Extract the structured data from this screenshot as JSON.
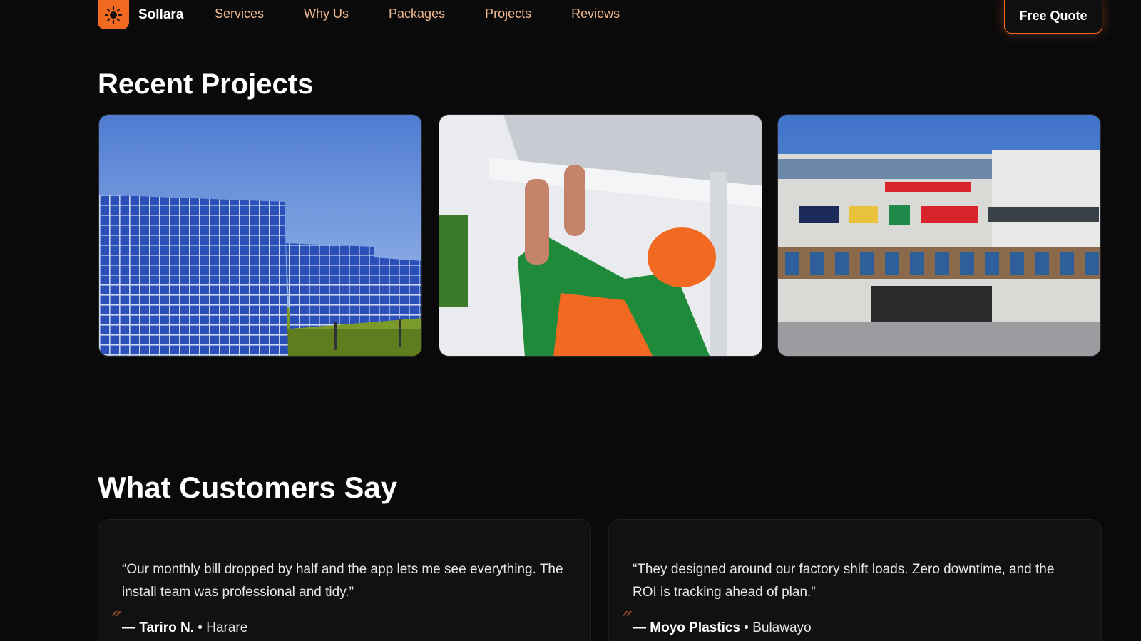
{
  "brand": {
    "name": "Sollara",
    "logo_icon": "sun-icon",
    "accent": "#f26a21"
  },
  "nav": {
    "links": [
      "Services",
      "Why Us",
      "Packages",
      "Projects",
      "Reviews"
    ],
    "cta": "Free Quote"
  },
  "projects": {
    "title": "Recent Projects"
  },
  "testimonials": {
    "title": "What Customers Say",
    "items": [
      {
        "quote": "“Our monthly bill dropped by half and the app lets me see everything. The install team was professional and tidy.”",
        "author": "— Tariro N.",
        "location": "Harare"
      },
      {
        "quote": "“They designed around our factory shift loads. Zero downtime, and the ROI is tracking ahead of plan.”",
        "author": "— Moyo Plastics",
        "location": "Bulawayo"
      }
    ]
  },
  "colors": {
    "background": "#0a0a0b",
    "nav_link": "#f0b98f",
    "card": "#111114"
  }
}
